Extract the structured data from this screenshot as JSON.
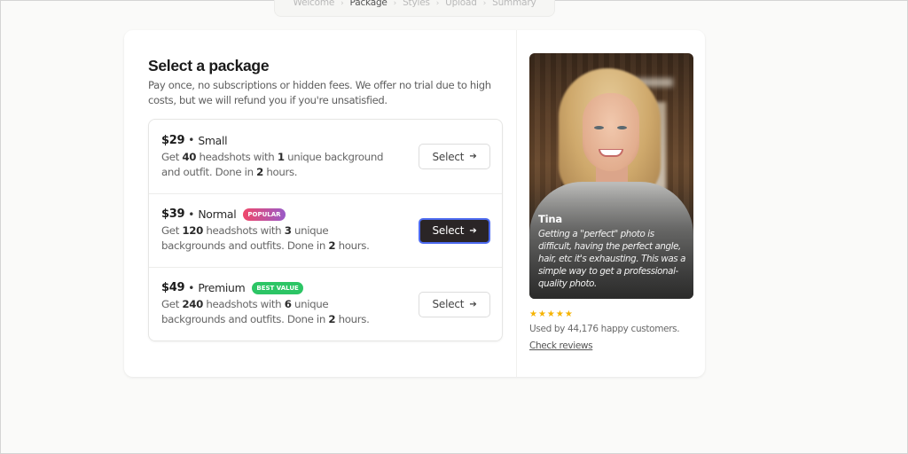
{
  "breadcrumb": {
    "steps": [
      "Welcome",
      "Package",
      "Styles",
      "Upload",
      "Summary"
    ],
    "active_index": 1
  },
  "main": {
    "title": "Select a package",
    "subtitle": "Pay once, no subscriptions or hidden fees. We offer no trial due to high costs, but we will refund you if you're unsatisfied."
  },
  "packages": [
    {
      "price": "$29",
      "separator": "•",
      "name": "Small",
      "badge": null,
      "headshots": "40",
      "backgrounds": "1",
      "desc_pre": "Get ",
      "desc_mid1": " headshots with ",
      "desc_mid2": " unique background and outfit. Done in ",
      "hours": "2",
      "desc_end": " hours.",
      "button_label": "Select",
      "button_icon": "arrow-right-icon",
      "highlighted": false
    },
    {
      "price": "$39",
      "separator": "•",
      "name": "Normal",
      "badge": "POPULAR",
      "headshots": "120",
      "backgrounds": "3",
      "desc_pre": "Get ",
      "desc_mid1": " headshots with ",
      "desc_mid2": " unique backgrounds and outfits. Done in ",
      "hours": "2",
      "desc_end": " hours.",
      "button_label": "Select",
      "button_icon": "arrow-right-icon",
      "highlighted": true
    },
    {
      "price": "$49",
      "separator": "•",
      "name": "Premium",
      "badge": "BEST VALUE",
      "headshots": "240",
      "backgrounds": "6",
      "desc_pre": "Get ",
      "desc_mid1": " headshots with ",
      "desc_mid2": " unique backgrounds and outfits. Done in ",
      "hours": "2",
      "desc_end": " hours.",
      "button_label": "Select",
      "button_icon": "arrow-right-icon",
      "highlighted": false
    }
  ],
  "testimonial": {
    "name": "Tina",
    "quote": "Getting a \"perfect\" photo is difficult, having the perfect angle, hair, etc it's exhausting. This was a simple way to get a professional-quality photo.",
    "rating": 5,
    "stars": "★★★★★",
    "used_by": "Used by 44,176 happy customers.",
    "reviews_link": "Check reviews"
  },
  "colors": {
    "primary_button": "#2a2526",
    "primary_button_ring": "#4d6bf0",
    "popular_badge_from": "#f0486a",
    "popular_badge_to": "#9a5ac8",
    "best_value_badge": "#2cc565",
    "stars": "#f5b301"
  },
  "arrow_glyph": "➔"
}
